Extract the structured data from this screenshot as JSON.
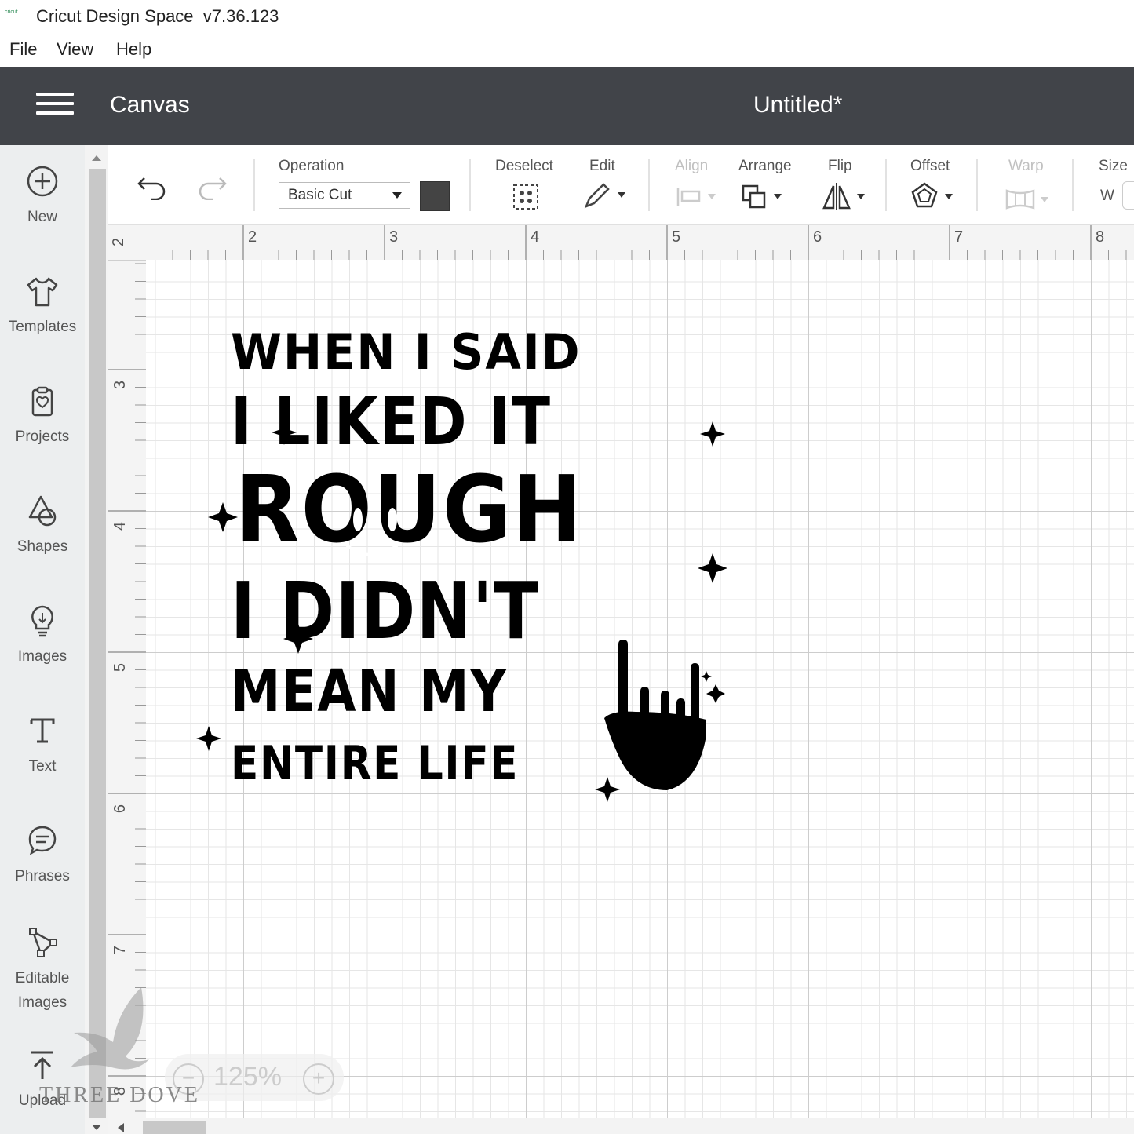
{
  "window": {
    "logo_text": "cricut",
    "title": "Cricut Design Space  v7.36.123"
  },
  "menu": [
    "File",
    "View",
    "Help"
  ],
  "header": {
    "section": "Canvas",
    "project_title": "Untitled*"
  },
  "sidebar": {
    "items": [
      {
        "label": "New",
        "icon": "plus-circle-icon"
      },
      {
        "label": "Templates",
        "icon": "tshirt-icon"
      },
      {
        "label": "Projects",
        "icon": "clipboard-icon"
      },
      {
        "label": "Shapes",
        "icon": "shapes-icon"
      },
      {
        "label": "Images",
        "icon": "lightbulb-icon"
      },
      {
        "label": "Text",
        "icon": "text-t-icon"
      },
      {
        "label": "Phrases",
        "icon": "speech-bubble-icon"
      },
      {
        "label": "Editable\nImages",
        "icon": "editable-image-icon"
      },
      {
        "label": "Upload",
        "icon": "upload-arrow-icon"
      }
    ]
  },
  "toolbar": {
    "operation_label": "Operation",
    "operation_value": "Basic Cut",
    "swatch_color": "#444444",
    "deselect_label": "Deselect",
    "edit_label": "Edit",
    "align_label": "Align",
    "arrange_label": "Arrange",
    "flip_label": "Flip",
    "offset_label": "Offset",
    "warp_label": "Warp",
    "size_label": "Size",
    "size_w": "W"
  },
  "rulers": {
    "top": [
      "2",
      "2",
      "3",
      "4",
      "5",
      "6",
      "7",
      "8"
    ],
    "left": [
      "3",
      "4",
      "5",
      "6",
      "7",
      "8"
    ]
  },
  "design": {
    "lines": [
      "WHEN I SAID",
      "I LIKED IT",
      "ROUGH",
      "I DIDN'T",
      "MEAN MY",
      "ENTIRE LIFE"
    ]
  },
  "zoom": {
    "minus": "−",
    "value": "125%",
    "plus": "+"
  },
  "watermark": "THREE DOVE"
}
